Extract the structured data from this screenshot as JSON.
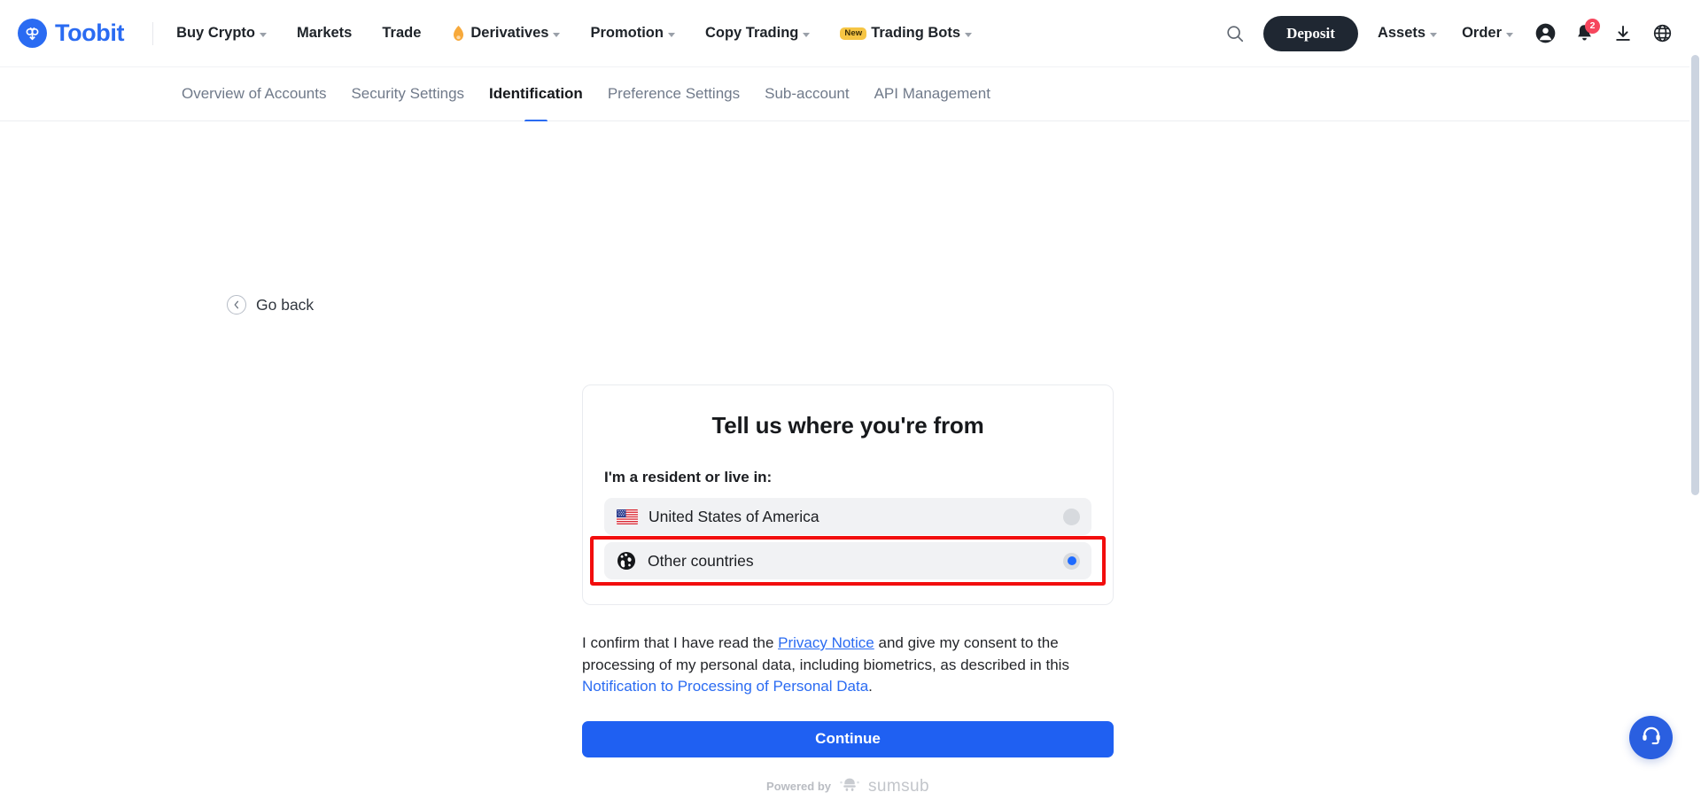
{
  "brand": {
    "name": "Toobit",
    "logo_icon": "toobit-logo-icon",
    "color": "#2a6bf2"
  },
  "topnav": {
    "items": [
      {
        "label": "Buy Crypto",
        "has_caret": true,
        "icon": null,
        "badge": null
      },
      {
        "label": "Markets",
        "has_caret": false,
        "icon": null,
        "badge": null
      },
      {
        "label": "Trade",
        "has_caret": false,
        "icon": null,
        "badge": null
      },
      {
        "label": "Derivatives",
        "has_caret": true,
        "icon": "flame-icon",
        "badge": null
      },
      {
        "label": "Promotion",
        "has_caret": true,
        "icon": null,
        "badge": null
      },
      {
        "label": "Copy Trading",
        "has_caret": true,
        "icon": null,
        "badge": null
      },
      {
        "label": "Trading Bots",
        "has_caret": true,
        "icon": null,
        "badge": "New"
      }
    ],
    "search_icon": "search-icon",
    "deposit_label": "Deposit",
    "assets_label": "Assets",
    "order_label": "Order",
    "profile_icon": "user-avatar-icon",
    "notification_icon": "bell-icon",
    "notification_count": "2",
    "download_icon": "download-icon",
    "language_icon": "globe-language-icon"
  },
  "subnav": {
    "items": [
      {
        "label": "Overview of Accounts",
        "active": false
      },
      {
        "label": "Security Settings",
        "active": false
      },
      {
        "label": "Identification",
        "active": true
      },
      {
        "label": "Preference Settings",
        "active": false
      },
      {
        "label": "Sub-account",
        "active": false
      },
      {
        "label": "API Management",
        "active": false
      }
    ],
    "active_underline_color": "#2a6bf2"
  },
  "go_back": {
    "label": "Go back",
    "icon": "chevron-left-circle-icon"
  },
  "kyc_card": {
    "title": "Tell us where you're from",
    "subtitle": "I'm a resident or live in:",
    "options": [
      {
        "label": "United States of America",
        "icon": "us-flag-icon",
        "selected": false,
        "highlighted": false
      },
      {
        "label": "Other countries",
        "icon": "globe-icon",
        "selected": true,
        "highlighted": true
      }
    ]
  },
  "consent": {
    "part1": "I confirm that I have read the ",
    "link1": "Privacy Notice",
    "part2": " and give my consent to the processing of my personal data, including biometrics, as described in this ",
    "link2": "Notification to Processing of Personal Data",
    "part3": "."
  },
  "continue_button": {
    "label": "Continue",
    "color": "#1f60f2"
  },
  "powered_by": {
    "label": "Powered by",
    "vendor": "sumsub",
    "icon": "sumsub-logo-icon"
  },
  "support": {
    "icon": "headset-support-icon",
    "color": "#2a5fe0"
  }
}
